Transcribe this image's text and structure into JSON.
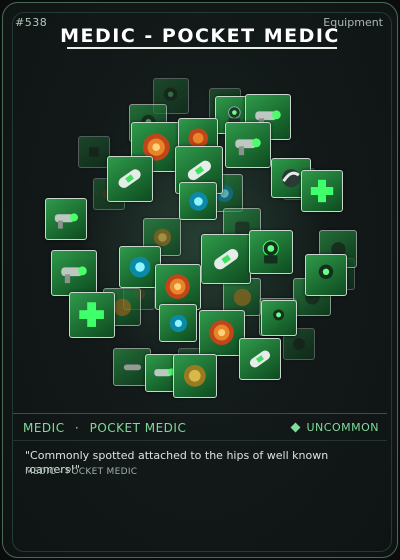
{
  "card": {
    "id": "#538",
    "type": "Equipment",
    "title": "MEDIC - POCKET MEDIC",
    "category": "MEDIC",
    "separator": "·",
    "item_name": "POCKET MEDIC",
    "rarity": "UNCOMMON",
    "flavor_text": "\"Commonly spotted attached to the hips of well known roamers!\"",
    "subname": "MEDIC - POCKET MEDIC"
  },
  "colors": {
    "accent": "#7fdc9a",
    "tile_green": "#2f9a4a",
    "title": "#ffffff"
  },
  "art": {
    "icons": [
      "medkit-cross-icon",
      "stim-syringe-icon",
      "bio-grenade-icon",
      "heal-gun-icon",
      "healing-orb-icon",
      "droid-icon"
    ]
  }
}
